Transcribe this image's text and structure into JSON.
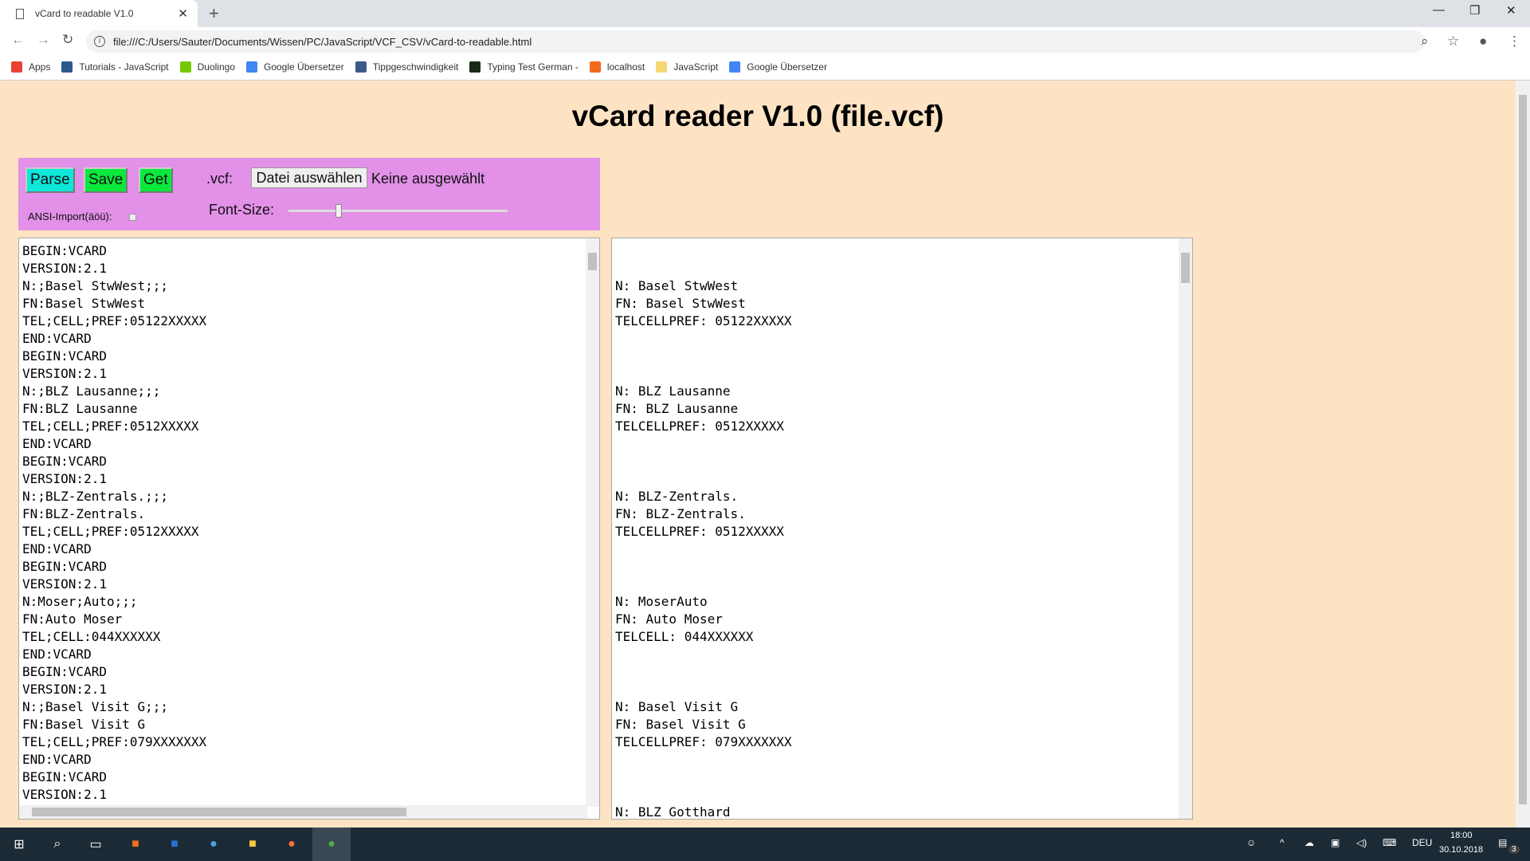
{
  "browser": {
    "tab_title": "vCard to readable V1.0",
    "url": "file:///C:/Users/Sauter/Documents/Wissen/PC/JavaScript/VCF_CSV/vCard-to-readable.html",
    "bookmarks": [
      {
        "label": "Apps",
        "color": "#e94235"
      },
      {
        "label": "Tutorials - JavaScript",
        "color": "#2d5a8e"
      },
      {
        "label": "Duolingo",
        "color": "#78c800"
      },
      {
        "label": "Google Übersetzer",
        "color": "#4285f4"
      },
      {
        "label": "Tippgeschwindigkeit",
        "color": "#3a5a8a"
      },
      {
        "label": "Typing Test German -",
        "color": "#1a2a1a"
      },
      {
        "label": "localhost",
        "color": "#f26b1d"
      },
      {
        "label": "JavaScript",
        "color": "#f6d776"
      },
      {
        "label": "Google Übersetzer",
        "color": "#4285f4"
      }
    ]
  },
  "page": {
    "title": "vCard reader V1.0 (file.vcf)",
    "buttons": {
      "parse": "Parse",
      "save": "Save",
      "get": "Get"
    },
    "vcf_label": ".vcf:",
    "file_button": "Datei auswählen",
    "file_status": "Keine ausgewählt",
    "ansi_label": "ANSI-Import(äöü):",
    "ansi_checked": false,
    "font_size_label": "Font-Size:",
    "font_size_slider_fraction": 0.22,
    "colors": {
      "background": "#fde3c3",
      "panel": "#e290e8",
      "parse": "#0de8da",
      "green": "#0ae83e"
    },
    "input_text": "BEGIN:VCARD\nVERSION:2.1\nN:;Basel StwWest;;;\nFN:Basel StwWest\nTEL;CELL;PREF:05122XXXXX\nEND:VCARD\nBEGIN:VCARD\nVERSION:2.1\nN:;BLZ Lausanne;;;\nFN:BLZ Lausanne\nTEL;CELL;PREF:0512XXXXX\nEND:VCARD\nBEGIN:VCARD\nVERSION:2.1\nN:;BLZ-Zentrals.;;;\nFN:BLZ-Zentrals.\nTEL;CELL;PREF:0512XXXXX\nEND:VCARD\nBEGIN:VCARD\nVERSION:2.1\nN:Moser;Auto;;;\nFN:Auto Moser\nTEL;CELL:044XXXXXX\nEND:VCARD\nBEGIN:VCARD\nVERSION:2.1\nN:;Basel Visit G;;;\nFN:Basel Visit G\nTEL;CELL;PREF:079XXXXXXX\nEND:VCARD\nBEGIN:VCARD\nVERSION:2.1",
    "output_text": "\n\nN: Basel StwWest\nFN: Basel StwWest\nTELCELLPREF: 05122XXXXX\n\n\n\nN: BLZ Lausanne\nFN: BLZ Lausanne\nTELCELLPREF: 0512XXXXX\n\n\n\nN: BLZ-Zentrals.\nFN: BLZ-Zentrals.\nTELCELLPREF: 0512XXXXX\n\n\n\nN: MoserAuto\nFN: Auto Moser\nTELCELL: 044XXXXXX\n\n\n\nN: Basel Visit G\nFN: Basel Visit G\nTELCELLPREF: 079XXXXXXX\n\n\n\nN: BLZ Gotthard"
  },
  "taskbar": {
    "language": "DEU",
    "time": "18:00",
    "date": "30.10.2018",
    "notifications": "3"
  }
}
